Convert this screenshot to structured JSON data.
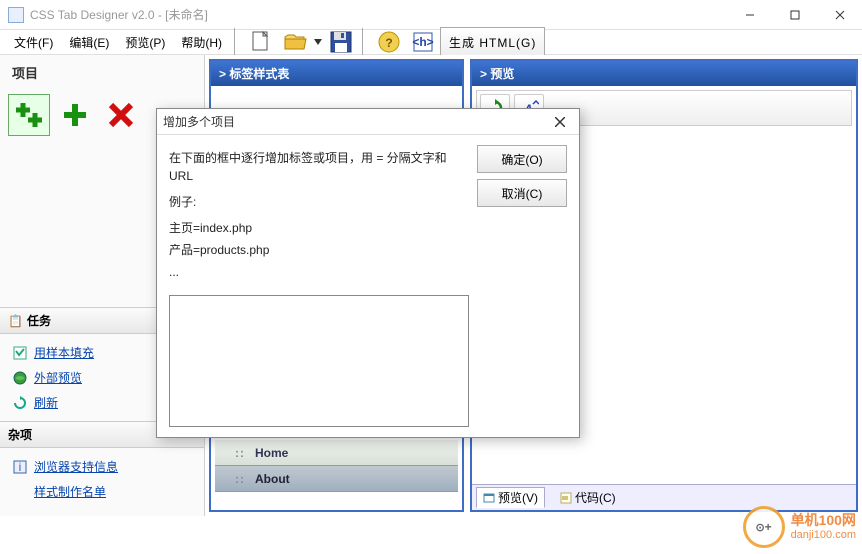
{
  "title": "CSS Tab Designer v2.0 - [未命名]",
  "menu": {
    "file": "文件(F)",
    "edit": "编辑(E)",
    "preview": "预览(P)",
    "help": "帮助(H)"
  },
  "toolbar": {
    "generate": "生成 HTML(G)"
  },
  "left": {
    "project": "项目",
    "tasks_header": "任务",
    "task_fillsample": "用样本填充",
    "task_extpreview": "外部预览",
    "task_refresh": "刷新",
    "misc_header": "杂项",
    "misc_browser": "浏览器支持信息",
    "misc_credits": "样式制作名单"
  },
  "panes": {
    "styles": "> 标签样式表",
    "preview": "> 预览"
  },
  "tabs_preview": {
    "home": "Home",
    "about": "About"
  },
  "bottom_tabs": {
    "preview": "预览(V)",
    "code": "代码(C)"
  },
  "dialog": {
    "title": "增加多个项目",
    "instruction": "在下面的框中逐行增加标签或项目，用 = 分隔文字和 URL",
    "example_label": "例子:",
    "example1": "主页=index.php",
    "example2": "产品=products.php",
    "example3": "...",
    "ok": "确定(O)",
    "cancel": "取消(C)"
  },
  "watermark": {
    "plus": "+",
    "cn": "单机100网",
    "en": "danji100.com"
  }
}
